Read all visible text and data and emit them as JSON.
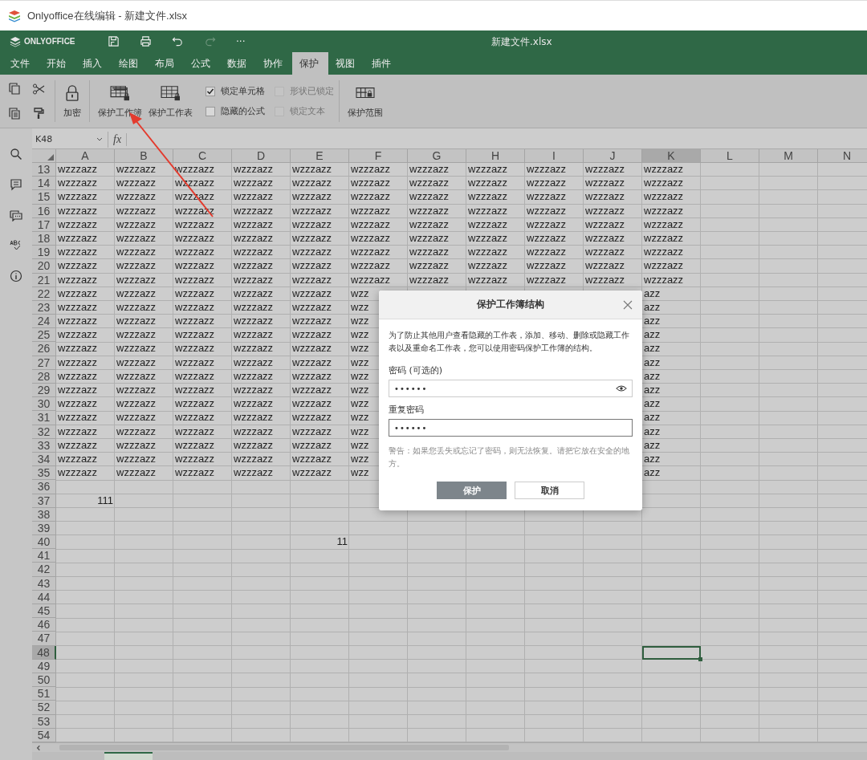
{
  "window": {
    "title": "Onlyoffice在线编辑 - 新建文件.xlsx"
  },
  "header": {
    "logo": "ONLYOFFICE",
    "document_title": "新建文件.xlsx",
    "redo_disabled": true,
    "more": "···"
  },
  "tabs": [
    {
      "label": "文件",
      "selected": false
    },
    {
      "label": "开始",
      "selected": false
    },
    {
      "label": "插入",
      "selected": false
    },
    {
      "label": "绘图",
      "selected": false
    },
    {
      "label": "布局",
      "selected": false
    },
    {
      "label": "公式",
      "selected": false
    },
    {
      "label": "数据",
      "selected": false
    },
    {
      "label": "协作",
      "selected": false
    },
    {
      "label": "保护",
      "selected": true
    },
    {
      "label": "视图",
      "selected": false
    },
    {
      "label": "插件",
      "selected": false
    }
  ],
  "toolbar": {
    "buttons": [
      {
        "label": "加密",
        "kind": "lock"
      },
      {
        "label": "保护工作簿",
        "kind": "workbook"
      },
      {
        "label": "保护工作表",
        "kind": "sheet"
      }
    ],
    "checkboxes": [
      {
        "label": "锁定单元格",
        "checked": true,
        "disabled": false
      },
      {
        "label": "形状已锁定",
        "checked": false,
        "disabled": true
      },
      {
        "label": "隐藏的公式",
        "checked": false,
        "disabled": false
      },
      {
        "label": "锁定文本",
        "checked": false,
        "disabled": true
      }
    ],
    "range_button": {
      "label": "保护范围"
    }
  },
  "sheet": {
    "name_box": "K48",
    "formula_icon": "fx",
    "columns": [
      {
        "label": "A",
        "selected": false
      },
      {
        "label": "B",
        "selected": false
      },
      {
        "label": "C",
        "selected": false
      },
      {
        "label": "D",
        "selected": false
      },
      {
        "label": "E",
        "selected": false
      },
      {
        "label": "F",
        "selected": false
      },
      {
        "label": "G",
        "selected": false
      },
      {
        "label": "H",
        "selected": false
      },
      {
        "label": "I",
        "selected": false
      },
      {
        "label": "J",
        "selected": false
      },
      {
        "label": "K",
        "selected": true
      },
      {
        "label": "L",
        "selected": false
      },
      {
        "label": "M",
        "selected": false
      },
      {
        "label": "N",
        "selected": false
      }
    ],
    "rows": [
      {
        "number": "13",
        "selected": false,
        "kind": "text",
        "cells": [
          "wzzzazz",
          "wzzzazz",
          "wzzzazz",
          "wzzzazz",
          "wzzzazz",
          "wzzzazz",
          "wzzzazz",
          "wzzzazz",
          "wzzzazz",
          "wzzzazz",
          "wzzzazz"
        ]
      },
      {
        "number": "14",
        "selected": false,
        "kind": "text",
        "cells": [
          "wzzzazz",
          "wzzzazz",
          "wzzzazz",
          "wzzzazz",
          "wzzzazz",
          "wzzzazz",
          "wzzzazz",
          "wzzzazz",
          "wzzzazz",
          "wzzzazz",
          "wzzzazz"
        ]
      },
      {
        "number": "15",
        "selected": false,
        "kind": "text",
        "cells": [
          "wzzzazz",
          "wzzzazz",
          "wzzzazz",
          "wzzzazz",
          "wzzzazz",
          "wzzzazz",
          "wzzzazz",
          "wzzzazz",
          "wzzzazz",
          "wzzzazz",
          "wzzzazz"
        ]
      },
      {
        "number": "16",
        "selected": false,
        "kind": "text",
        "cells": [
          "wzzzazz",
          "wzzzazz",
          "wzzzazz",
          "wzzzazz",
          "wzzzazz",
          "wzzzazz",
          "wzzzazz",
          "wzzzazz",
          "wzzzazz",
          "wzzzazz",
          "wzzzazz"
        ]
      },
      {
        "number": "17",
        "selected": false,
        "kind": "text",
        "cells": [
          "wzzzazz",
          "wzzzazz",
          "wzzzazz",
          "wzzzazz",
          "wzzzazz",
          "wzzzazz",
          "wzzzazz",
          "wzzzazz",
          "wzzzazz",
          "wzzzazz",
          "wzzzazz"
        ]
      },
      {
        "number": "18",
        "selected": false,
        "kind": "text",
        "cells": [
          "wzzzazz",
          "wzzzazz",
          "wzzzazz",
          "wzzzazz",
          "wzzzazz",
          "wzzzazz",
          "wzzzazz",
          "wzzzazz",
          "wzzzazz",
          "wzzzazz",
          "wzzzazz"
        ]
      },
      {
        "number": "19",
        "selected": false,
        "kind": "text",
        "cells": [
          "wzzzazz",
          "wzzzazz",
          "wzzzazz",
          "wzzzazz",
          "wzzzazz",
          "wzzzazz",
          "wzzzazz",
          "wzzzazz",
          "wzzzazz",
          "wzzzazz",
          "wzzzazz"
        ]
      },
      {
        "number": "20",
        "selected": false,
        "kind": "text",
        "cells": [
          "wzzzazz",
          "wzzzazz",
          "wzzzazz",
          "wzzzazz",
          "wzzzazz",
          "wzzzazz",
          "wzzzazz",
          "wzzzazz",
          "wzzzazz",
          "wzzzazz",
          "wzzzazz"
        ]
      },
      {
        "number": "21",
        "selected": false,
        "kind": "text",
        "cells": [
          "wzzzazz",
          "wzzzazz",
          "wzzzazz",
          "wzzzazz",
          "wzzzazz",
          "wzzzazz",
          "wzzzazz",
          "wzzzazz",
          "wzzzazz",
          "wzzzazz",
          "wzzzazz"
        ]
      },
      {
        "number": "22",
        "selected": false,
        "kind": "text",
        "cells": [
          "wzzzazz",
          "wzzzazz",
          "wzzzazz",
          "wzzzazz",
          "wzzzazz",
          "wzz",
          null,
          null,
          null,
          null,
          "azz"
        ]
      },
      {
        "number": "23",
        "selected": false,
        "kind": "text",
        "cells": [
          "wzzzazz",
          "wzzzazz",
          "wzzzazz",
          "wzzzazz",
          "wzzzazz",
          "wzz",
          null,
          null,
          null,
          null,
          "azz"
        ]
      },
      {
        "number": "24",
        "selected": false,
        "kind": "text",
        "cells": [
          "wzzzazz",
          "wzzzazz",
          "wzzzazz",
          "wzzzazz",
          "wzzzazz",
          "wzz",
          null,
          null,
          null,
          null,
          "azz"
        ]
      },
      {
        "number": "25",
        "selected": false,
        "kind": "text",
        "cells": [
          "wzzzazz",
          "wzzzazz",
          "wzzzazz",
          "wzzzazz",
          "wzzzazz",
          "wzz",
          null,
          null,
          null,
          null,
          "azz"
        ]
      },
      {
        "number": "26",
        "selected": false,
        "kind": "text",
        "cells": [
          "wzzzazz",
          "wzzzazz",
          "wzzzazz",
          "wzzzazz",
          "wzzzazz",
          "wzz",
          null,
          null,
          null,
          null,
          "azz"
        ]
      },
      {
        "number": "27",
        "selected": false,
        "kind": "text",
        "cells": [
          "wzzzazz",
          "wzzzazz",
          "wzzzazz",
          "wzzzazz",
          "wzzzazz",
          "wzz",
          null,
          null,
          null,
          null,
          "azz"
        ]
      },
      {
        "number": "28",
        "selected": false,
        "kind": "text",
        "cells": [
          "wzzzazz",
          "wzzzazz",
          "wzzzazz",
          "wzzzazz",
          "wzzzazz",
          "wzz",
          null,
          null,
          null,
          null,
          "azz"
        ]
      },
      {
        "number": "29",
        "selected": false,
        "kind": "text",
        "cells": [
          "wzzzazz",
          "wzzzazz",
          "wzzzazz",
          "wzzzazz",
          "wzzzazz",
          "wzz",
          null,
          null,
          null,
          null,
          "azz"
        ]
      },
      {
        "number": "30",
        "selected": false,
        "kind": "text",
        "cells": [
          "wzzzazz",
          "wzzzazz",
          "wzzzazz",
          "wzzzazz",
          "wzzzazz",
          "wzz",
          null,
          null,
          null,
          null,
          "azz"
        ]
      },
      {
        "number": "31",
        "selected": false,
        "kind": "text",
        "cells": [
          "wzzzazz",
          "wzzzazz",
          "wzzzazz",
          "wzzzazz",
          "wzzzazz",
          "wzz",
          null,
          null,
          null,
          null,
          "azz"
        ]
      },
      {
        "number": "32",
        "selected": false,
        "kind": "text",
        "cells": [
          "wzzzazz",
          "wzzzazz",
          "wzzzazz",
          "wzzzazz",
          "wzzzazz",
          "wzz",
          null,
          null,
          null,
          null,
          "azz"
        ]
      },
      {
        "number": "33",
        "selected": false,
        "kind": "text",
        "cells": [
          "wzzzazz",
          "wzzzazz",
          "wzzzazz",
          "wzzzazz",
          "wzzzazz",
          "wzz",
          null,
          null,
          null,
          null,
          "azz"
        ]
      },
      {
        "number": "34",
        "selected": false,
        "kind": "text",
        "cells": [
          "wzzzazz",
          "wzzzazz",
          "wzzzazz",
          "wzzzazz",
          "wzzzazz",
          "wzz",
          null,
          null,
          null,
          null,
          "azz"
        ]
      },
      {
        "number": "35",
        "selected": false,
        "kind": "text",
        "cells": [
          "wzzzazz",
          "wzzzazz",
          "wzzzazz",
          "wzzzazz",
          "wzzzazz",
          "wzz",
          null,
          null,
          null,
          null,
          "azz"
        ]
      },
      {
        "number": "36",
        "selected": false
      },
      {
        "number": "37",
        "selected": false,
        "kind": "number",
        "cells": [
          "111"
        ]
      },
      {
        "number": "38",
        "selected": false
      },
      {
        "number": "39",
        "selected": false
      },
      {
        "number": "40",
        "selected": false,
        "kind": "number",
        "cells": [
          null,
          null,
          null,
          null,
          "11"
        ]
      },
      {
        "number": "41",
        "selected": false
      },
      {
        "number": "42",
        "selected": false
      },
      {
        "number": "43",
        "selected": false
      },
      {
        "number": "44",
        "selected": false
      },
      {
        "number": "45",
        "selected": false
      },
      {
        "number": "46",
        "selected": false
      },
      {
        "number": "47",
        "selected": false
      },
      {
        "number": "48",
        "selected": true
      },
      {
        "number": "49",
        "selected": false
      },
      {
        "number": "50",
        "selected": false
      },
      {
        "number": "51",
        "selected": false
      },
      {
        "number": "52",
        "selected": false
      },
      {
        "number": "53",
        "selected": false
      },
      {
        "number": "54",
        "selected": false
      }
    ]
  },
  "dialog": {
    "title": "保护工作簿结构",
    "description": "为了防止其他用户查看隐藏的工作表，添加、移动、删除或隐藏工作表以及重命名工作表，您可以使用密码保护工作簿的结构。",
    "password_label": "密码 (可选的)",
    "password_value": "••••••",
    "repeat_label": "重复密码",
    "repeat_value": "••••••",
    "warning": "警告：如果您丢失或忘记了密码，则无法恢复。请把它放在安全的地方。",
    "buttons": [
      {
        "label": "保护",
        "kind": "primary"
      },
      {
        "label": "取消",
        "kind": "secondary"
      }
    ]
  }
}
